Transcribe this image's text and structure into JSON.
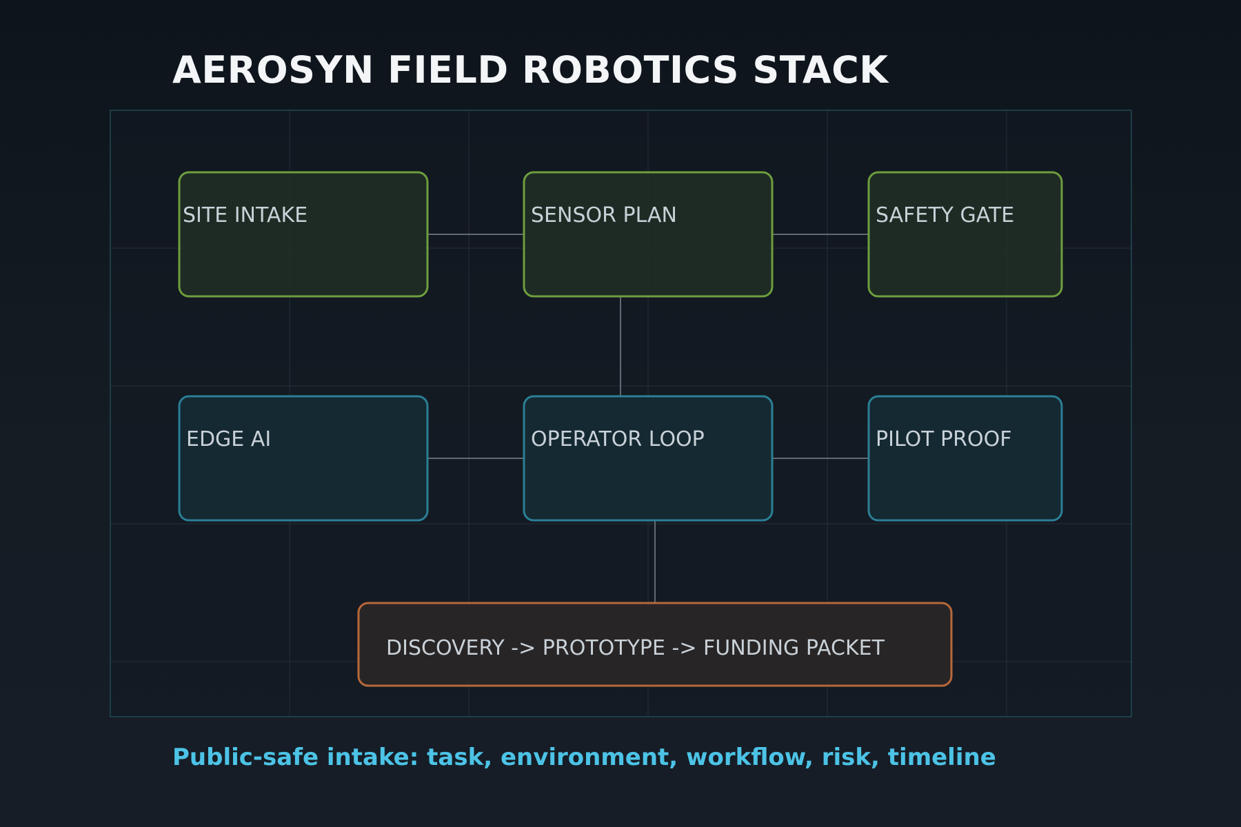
{
  "title": "AEROSYN FIELD ROBOTICS STACK",
  "footer": "Public-safe intake: task, environment, workflow, risk, timeline",
  "nodes": {
    "site_intake": "SITE INTAKE",
    "sensor_plan": "SENSOR PLAN",
    "safety_gate": "SAFETY GATE",
    "edge_ai": "EDGE AI",
    "operator_loop": "OPERATOR LOOP",
    "pilot_proof": "PILOT PROOF",
    "pipeline": "DISCOVERY -> PROTOTYPE -> FUNDING PACKET"
  },
  "colors": {
    "background": "#11171e",
    "green_border": "#6e9e3e",
    "green_fill": "#212f25",
    "teal_border": "#2b7f96",
    "teal_fill": "#162b34",
    "orange_border": "#b8693a",
    "orange_fill": "#2a2627",
    "title": "#f3f5f7",
    "footer": "#4cc3e6",
    "label": "#c9d1d8"
  }
}
